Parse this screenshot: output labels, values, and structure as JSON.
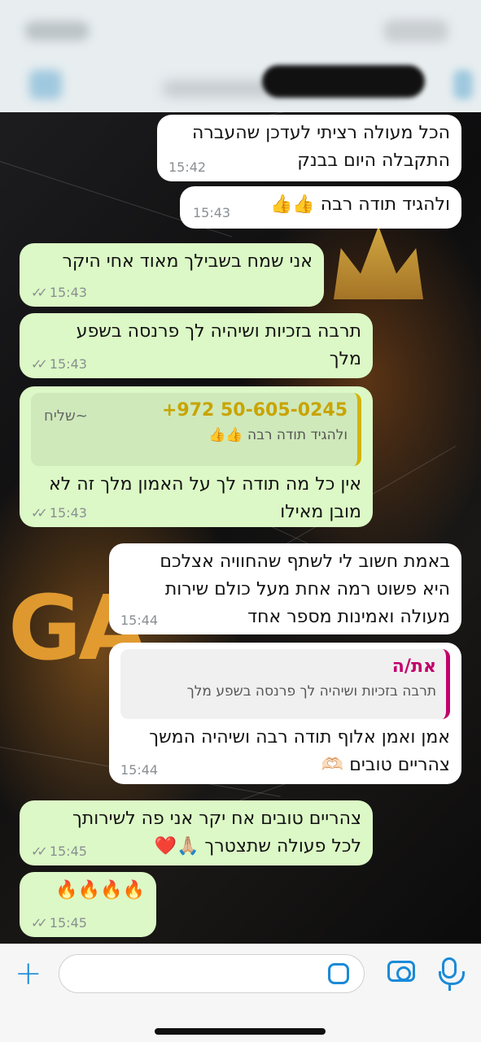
{
  "header": {
    "contact_name_blurred": "",
    "redacted": true
  },
  "messages": [
    {
      "id": "m1",
      "dir": "in",
      "lines": [
        "הכל מעולה רציתי לעדכן שהעברה",
        "התקבלה היום בבנק"
      ],
      "time": "15:42"
    },
    {
      "id": "m2",
      "dir": "in",
      "lines": [
        "ולהגיד תודה רבה 👍👍"
      ],
      "time": "15:43"
    },
    {
      "id": "m3",
      "dir": "out",
      "lines": [
        "אני שמח בשבילך מאוד אחי היקר"
      ],
      "time": "15:43"
    },
    {
      "id": "m4",
      "dir": "out",
      "lines": [
        "תרבה בזכיות ושיהיה לך פרנסה בשפע",
        "מלך"
      ],
      "time": "15:43"
    },
    {
      "id": "m5",
      "dir": "out",
      "quote": {
        "name": "+972 50-605-0245",
        "text": "ולהגיד תודה רבה 👍👍",
        "extra": "~שליח"
      },
      "lines": [
        "אין כל מה תודה לך על האמון מלך זה לא",
        "מובן מאילו"
      ],
      "time": "15:43"
    },
    {
      "id": "m6",
      "dir": "in",
      "lines": [
        "באמת חשוב לי לשתף שהחוויה אצלכם",
        "היא פשוט רמה אחת מעל כולם שירות",
        "מעולה ואמינות מספר אחד"
      ],
      "time": "15:44"
    },
    {
      "id": "m7",
      "dir": "in",
      "quote": {
        "name": "את/ה",
        "text": "תרבה בזכיות ושיהיה לך פרנסה בשפע מלך"
      },
      "lines": [
        "אמן ואמן אלוף תודה רבה ושיהיה המשך",
        "צהריים טובים 🫶🏻"
      ],
      "time": "15:44"
    },
    {
      "id": "m8",
      "dir": "out",
      "lines": [
        "צהריים טובים אח יקר אני פה לשירותך",
        "לכל פעולה שתצטרך 🙏🏼❤️"
      ],
      "time": "15:45"
    },
    {
      "id": "m9",
      "dir": "out",
      "lines": [
        "🔥🔥🔥🔥"
      ],
      "time": "15:45"
    }
  ],
  "background": {
    "logo_text": "GA"
  },
  "input_bar": {
    "placeholder": "",
    "plus_icon": "plus-icon",
    "sticker_icon": "sticker-icon",
    "camera_icon": "camera-icon",
    "mic_icon": "microphone-icon",
    "accent": "#1a8ad8"
  },
  "colors": {
    "incoming_bubble": "#ffffff",
    "outgoing_bubble": "#dcf8c6",
    "quote_bar_contact": "#d4b400",
    "quote_bar_you": "#c2006b"
  }
}
